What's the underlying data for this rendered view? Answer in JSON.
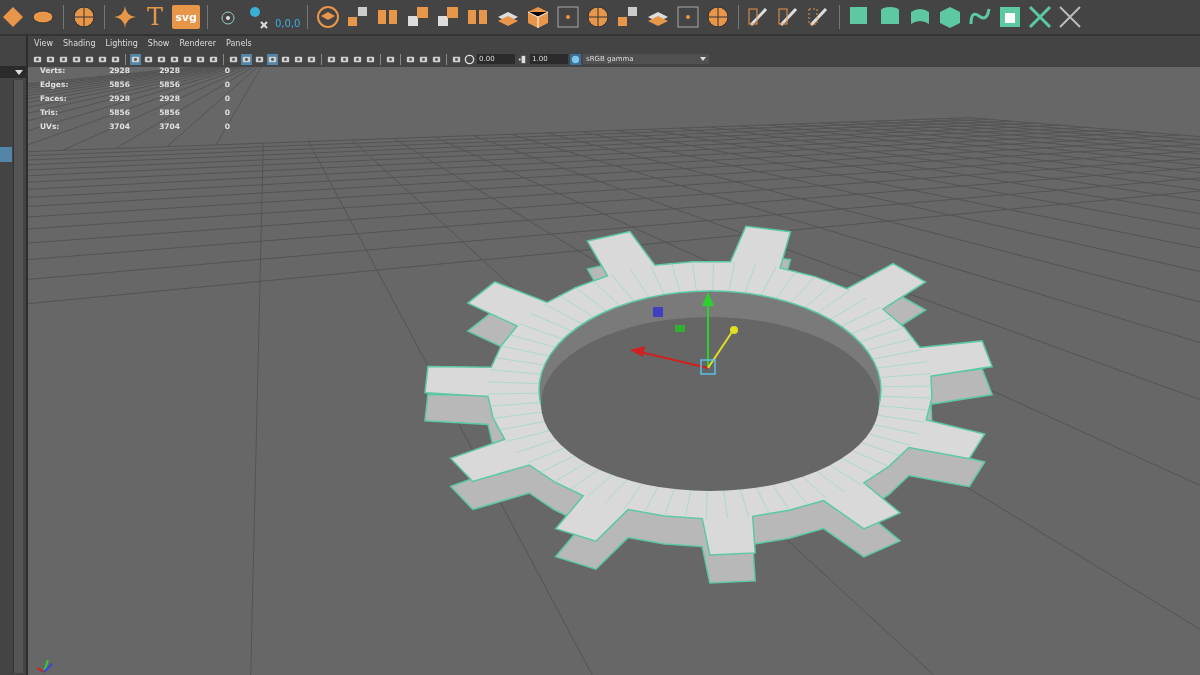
{
  "shelf": {
    "text_tools": [
      "T",
      "svg",
      "0,0,0"
    ]
  },
  "panel_menu": [
    "View",
    "Shading",
    "Lighting",
    "Show",
    "Renderer",
    "Panels"
  ],
  "panel_toolbar": {
    "exposure": "0.00",
    "gamma": "1.00",
    "color_space": "sRGB gamma"
  },
  "hud": [
    {
      "label": "Verts:",
      "column_1": "2928",
      "column_2": "2928",
      "column_3": "0"
    },
    {
      "label": "Edges:",
      "column_1": "5856",
      "column_2": "5856",
      "column_3": "0"
    },
    {
      "label": "Faces:",
      "column_1": "2928",
      "column_2": "2928",
      "column_3": "0"
    },
    {
      "label": "Tris:",
      "column_1": "5856",
      "column_2": "5856",
      "column_3": "0"
    },
    {
      "label": "UVs:",
      "column_1": "3704",
      "column_2": "3704",
      "column_3": "0"
    }
  ]
}
